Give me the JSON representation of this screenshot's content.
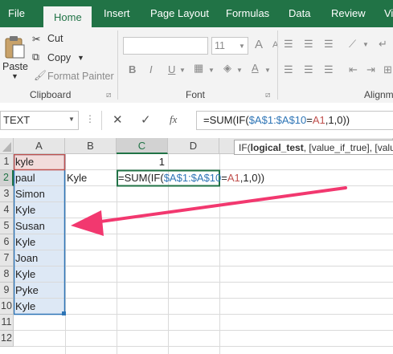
{
  "ribbon": {
    "tabs": [
      "File",
      "Home",
      "Insert",
      "Page Layout",
      "Formulas",
      "Data",
      "Review",
      "Vi"
    ],
    "active_tab": "Home",
    "clipboard": {
      "paste": "Paste",
      "cut": "Cut",
      "copy": "Copy",
      "format_painter": "Format Painter",
      "label": "Clipboard"
    },
    "font": {
      "size": "11",
      "bold": "B",
      "italic": "I",
      "underline": "U",
      "grow": "A",
      "shrink": "A",
      "label": "Font"
    },
    "alignment": {
      "label": "Alignm"
    }
  },
  "formula_bar": {
    "name_box": "TEXT",
    "cancel": "✕",
    "enter": "✓",
    "fx": "fx",
    "formula_prefix": "=SUM(IF(",
    "formula_range": "$A$1:$A$10",
    "formula_eq": "=",
    "formula_ref": "A1",
    "formula_suffix": ",1,0))"
  },
  "tooltip": {
    "func": "IF(",
    "arg1": "logical_test",
    "rest": ", [value_if_true], [value_if_false])"
  },
  "grid": {
    "columns": [
      "A",
      "B",
      "C",
      "D"
    ],
    "rows": [
      "1",
      "2",
      "3",
      "4",
      "5",
      "6",
      "7",
      "8",
      "9",
      "10",
      "11",
      "12"
    ],
    "column_a": [
      "kyle",
      "paul",
      "Simon",
      "Kyle",
      "Susan",
      "Kyle",
      "Joan",
      "Kyle",
      "Pyke",
      "Kyle"
    ],
    "b2": "Kyle",
    "c1": "1",
    "c2_prefix": "=SUM(IF(",
    "c2_range": "$A$1:$A$10",
    "c2_eq": "=",
    "c2_ref": "A1",
    "c2_suffix": ",1,0))"
  },
  "colors": {
    "excel_green": "#217346",
    "range_blue": "#2e75b6",
    "ref_red": "#c0504d",
    "annotation_arrow": "#f2386f"
  }
}
